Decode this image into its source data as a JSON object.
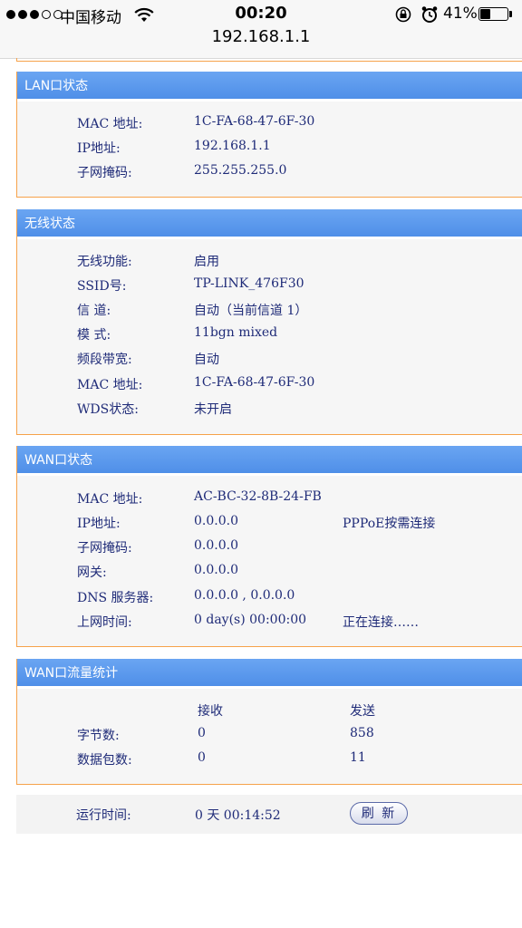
{
  "status_bar": {
    "carrier": "中国移动",
    "time": "00:20",
    "url": "192.168.1.1",
    "battery_percent_label": "41%",
    "battery_level": 0.41
  },
  "lan": {
    "title": "LAN口状态",
    "rows": [
      {
        "label": "MAC 地址:",
        "value": "1C-FA-68-47-6F-30"
      },
      {
        "label": "IP地址:",
        "value": "192.168.1.1"
      },
      {
        "label": "子网掩码:",
        "value": "255.255.255.0"
      }
    ]
  },
  "wireless": {
    "title": "无线状态",
    "rows": [
      {
        "label": "无线功能:",
        "value": "启用"
      },
      {
        "label": "SSID号:",
        "value": "TP-LINK_476F30"
      },
      {
        "label": "信 道:",
        "value": "自动（当前信道 1）"
      },
      {
        "label": "模 式:",
        "value": "11bgn mixed"
      },
      {
        "label": "频段带宽:",
        "value": "自动"
      },
      {
        "label": "MAC 地址:",
        "value": "1C-FA-68-47-6F-30"
      },
      {
        "label": "WDS状态:",
        "value": "未开启"
      }
    ]
  },
  "wan": {
    "title": "WAN口状态",
    "rows": [
      {
        "label": "MAC 地址:",
        "value": "AC-BC-32-8B-24-FB",
        "extra": ""
      },
      {
        "label": "IP地址:",
        "value": "0.0.0.0",
        "extra": "PPPoE按需连接"
      },
      {
        "label": "子网掩码:",
        "value": "0.0.0.0",
        "extra": ""
      },
      {
        "label": "网关:",
        "value": "0.0.0.0",
        "extra": ""
      },
      {
        "label": "DNS 服务器:",
        "value": "0.0.0.0 , 0.0.0.0",
        "extra": ""
      },
      {
        "label": "上网时间:",
        "value": "0 day(s) 00:00:00",
        "extra": "正在连接……"
      }
    ]
  },
  "traffic": {
    "title": "WAN口流量统计",
    "header": {
      "receive": "接收",
      "send": "发送"
    },
    "rows": [
      {
        "label": "字节数:",
        "receive": "0",
        "send": "858"
      },
      {
        "label": "数据包数:",
        "receive": "0",
        "send": "11"
      }
    ]
  },
  "runtime": {
    "label": "运行时间:",
    "value": "0 天 00:14:52",
    "refresh_label": "刷 新"
  }
}
